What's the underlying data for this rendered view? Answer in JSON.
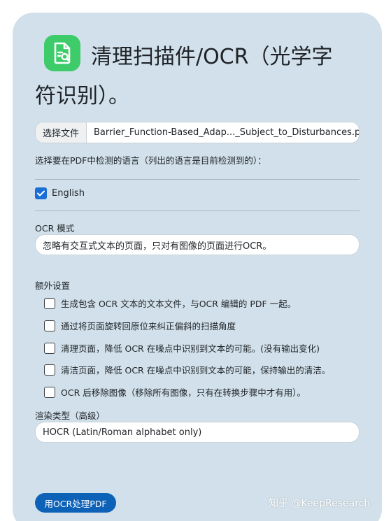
{
  "header": {
    "title_line1": "清理扫描件/OCR（光学字",
    "title_line2": "符识别）。",
    "icon": "document-search-icon"
  },
  "file_picker": {
    "button_label": "选择文件",
    "file_name": "Barrier_Function-Based_Adap..._Subject_to_Disturbances.pdf"
  },
  "languages": {
    "label": "选择要在PDF中检测的语言（列出的语言是目前检测到的）：",
    "items": [
      {
        "label": "English",
        "checked": true
      }
    ]
  },
  "ocr_mode": {
    "label": "OCR 模式",
    "value": "忽略有交互式文本的页面，只对有图像的页面进行OCR。"
  },
  "extra_settings": {
    "label": "额外设置",
    "options": [
      {
        "label": "生成包含 OCR 文本的文本文件，与OCR 编辑的 PDF 一起。",
        "checked": false
      },
      {
        "label": "通过将页面旋转回原位来纠正偏斜的扫描角度",
        "checked": false
      },
      {
        "label": "清理页面，降低 OCR 在噪点中识别到文本的可能。(没有输出变化)",
        "checked": false
      },
      {
        "label": "清洁页面，降低 OCR 在噪点中识别到文本的可能，保持输出的清洁。",
        "checked": false
      },
      {
        "label": "OCR 后移除图像（移除所有图像，只有在转换步骤中才有用）。",
        "checked": false
      }
    ]
  },
  "render_type": {
    "label": "渲染类型（高级）",
    "value": "HOCR (Latin/Roman alphabet only)"
  },
  "submit": {
    "label": "用OCR处理PDF"
  },
  "watermark": "知乎 @KeepResearch",
  "colors": {
    "card_bg": "#d1e0ea",
    "icon_bg": "#3ecb6a",
    "accent": "#0d62b8",
    "checkbox": "#1a6fd6"
  }
}
